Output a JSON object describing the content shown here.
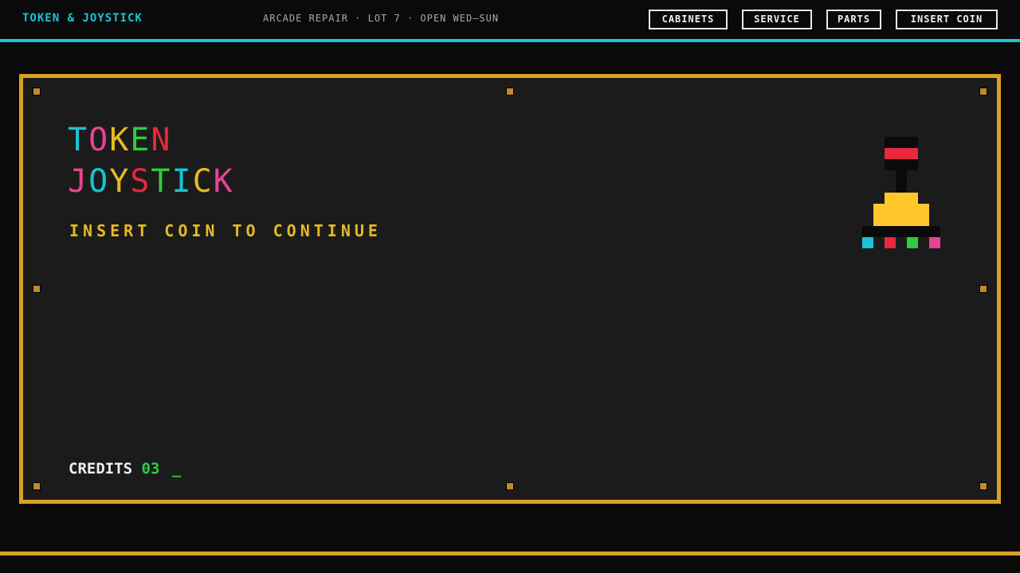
{
  "header": {
    "brand": "TOKEN & JOYSTICK",
    "tagline": "ARCADE REPAIR · LOT 7 · OPEN WED–SUN",
    "nav": [
      "CABINETS",
      "SERVICE",
      "PARTS",
      "INSERT COIN"
    ]
  },
  "hero": {
    "title_line1": [
      "T",
      "O",
      "K",
      "E",
      "N"
    ],
    "title_line1_colors": [
      "#18c4d4",
      "#e84393",
      "#e8b923",
      "#2ecc40",
      "#e8283c"
    ],
    "title_line2": [
      "J",
      "O",
      "Y",
      "S",
      "T",
      "I",
      "C",
      "K"
    ],
    "title_line2_colors": [
      "#e84393",
      "#18c4d4",
      "#e8b923",
      "#e8283c",
      "#2ecc40",
      "#18c4d4",
      "#e8b923",
      "#e84393"
    ],
    "subtitle": "INSERT COIN TO CONTINUE",
    "credits_label": "CREDITS",
    "credits_value": "03",
    "cursor": "_"
  },
  "colors": {
    "accent_cyan": "#18c4d4",
    "accent_gold": "#d9a126",
    "joystick_ball": "#e8283c",
    "joystick_base": "#ffc72c",
    "button_colors": [
      "#18c4d4",
      "#e8283c",
      "#2ecc40",
      "#e84393"
    ]
  }
}
